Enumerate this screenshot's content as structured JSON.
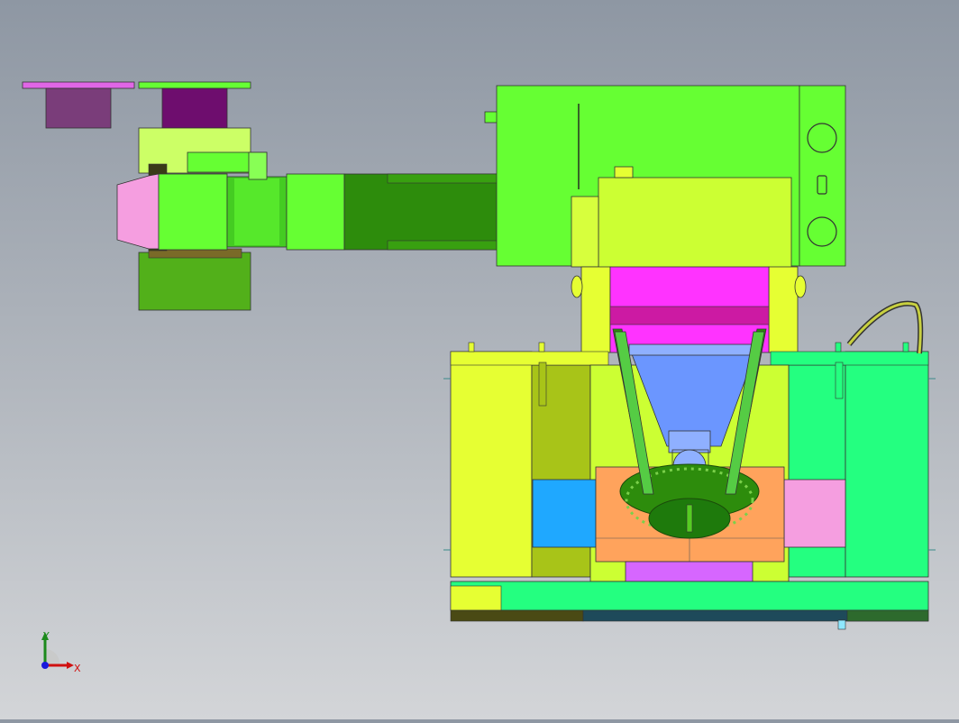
{
  "viewport": {
    "background_top": "#8e97a3",
    "background_bottom": "#d3d5d8"
  },
  "triad": {
    "x_label": "X",
    "y_label": "Y",
    "x_color": "#d01010",
    "y_color": "#1c8a1c",
    "z_color": "#1a1adc"
  },
  "colors": {
    "lime": "#66ff33",
    "dark_green": "#2d8c0c",
    "mid_green": "#52b01a",
    "pale_yellow_green": "#ccff66",
    "yellow": "#e6ff33",
    "olive": "#a8c418",
    "magenta": "#ff33ff",
    "dark_magenta": "#cc1aa3",
    "purple": "#7a3d7a",
    "pink": "#f59ee0",
    "blue": "#6b96ff",
    "cyan": "#1fa8ff",
    "orange": "#ffa35c",
    "mint": "#24ff80",
    "lavender": "#d666ff",
    "dark_base": "#2a4a4a"
  }
}
